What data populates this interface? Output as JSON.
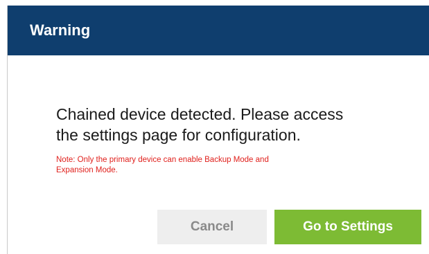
{
  "dialog": {
    "title": "Warning",
    "message_line1": "Chained device detected. Please access",
    "message_line2": "the settings page for configuration.",
    "note_line1": "Note: Only the primary device can enable Backup Mode and",
    "note_line2": "Expansion Mode.",
    "cancel_label": "Cancel",
    "confirm_label": "Go to Settings"
  },
  "colors": {
    "header_background": "#0f3e6e",
    "note_text": "#e0201c",
    "primary_button": "#7dbb34",
    "secondary_button": "#eeeeee"
  }
}
